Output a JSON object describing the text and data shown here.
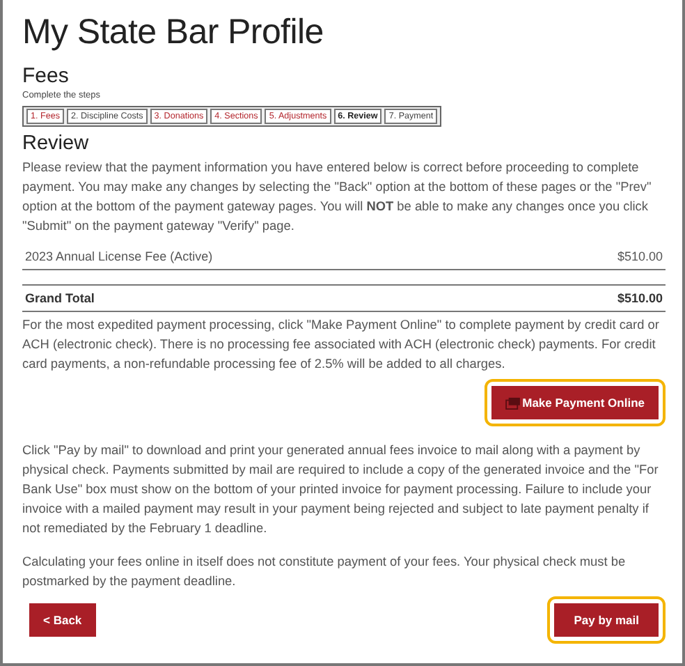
{
  "page_title": "My State Bar Profile",
  "section_title": "Fees",
  "steps_label": "Complete the steps",
  "steps": [
    {
      "label": "1. Fees",
      "kind": "link",
      "selected": false
    },
    {
      "label": "2. Discipline Costs",
      "kind": "plain",
      "selected": false
    },
    {
      "label": "3. Donations",
      "kind": "link",
      "selected": false
    },
    {
      "label": "4. Sections",
      "kind": "link",
      "selected": false
    },
    {
      "label": "5. Adjustments",
      "kind": "link",
      "selected": false
    },
    {
      "label": "6. Review",
      "kind": "plain",
      "selected": true
    },
    {
      "label": "7. Payment",
      "kind": "plain",
      "selected": false
    }
  ],
  "review": {
    "title": "Review",
    "intro": "Please review that the payment information you have entered below is correct before proceeding to complete payment. You may make any changes by selecting the \"Back\" option at the bottom of these pages or the \"Prev\" option at the bottom of the payment gateway pages. You will **NOT** be able to make any changes once you click \"Submit\" on the payment gateway \"Verify\" page."
  },
  "fees": [
    {
      "name": "2023 Annual License Fee (Active)",
      "amount": "$510.00"
    }
  ],
  "total": {
    "label": "Grand Total",
    "amount": "$510.00"
  },
  "online_text": "For the most expedited payment processing, click \"Make Payment Online\" to complete payment by credit card or ACH (electronic check). There is no processing fee associated with ACH (electronic check) payments. For credit card payments, a non-refundable processing fee of 2.5% will be added to all charges.",
  "online_button": {
    "label": "Make Payment Online",
    "highlighted": true
  },
  "mail_text": "Click \"Pay by mail\" to download and print your generated annual fees invoice to mail along with a payment by physical check. Payments submitted by mail are required to include a copy of the generated invoice and the \"For Bank Use\" box must show on the bottom of your printed invoice for payment processing. Failure to include your invoice with a mailed payment may result in your payment being rejected and subject to late payment penalty if not remediated by the February 1 deadline.",
  "note_text": "Calculating your fees online in itself does not constitute payment of your fees. Your physical check must be postmarked by the payment deadline.",
  "back_button": {
    "label": "< Back",
    "highlighted": false
  },
  "mail_button": {
    "label": "Pay by mail",
    "highlighted": true
  }
}
